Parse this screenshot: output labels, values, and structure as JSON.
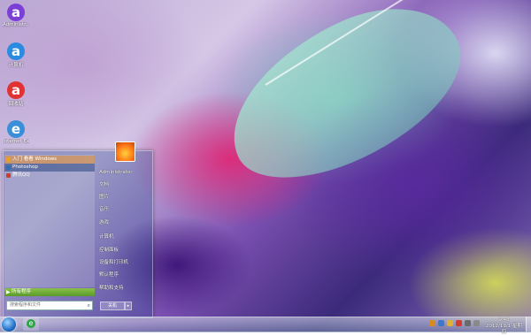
{
  "desktop_icons": [
    {
      "label": "Administr...",
      "glyph": "a",
      "color": "#7b3fd6"
    },
    {
      "label": "计算机",
      "glyph": "a",
      "color": "#2a8be0"
    },
    {
      "label": "回收站",
      "glyph": "a",
      "color": "#e03232"
    },
    {
      "label": "Internet Explorer",
      "glyph": "e",
      "color": "#3a8fd8"
    }
  ],
  "start_menu": {
    "programs": [
      {
        "label": "入门 看看 Windows",
        "color": "#e8a020"
      },
      {
        "label": "Photoshop",
        "color": "#2c6fb8"
      },
      {
        "label": "腾讯QQ",
        "color": "#d23a2a"
      }
    ],
    "all_programs": "所有程序",
    "search_placeholder": "搜索程序和文件",
    "user": "Administrator",
    "right_items": [
      "文档",
      "图片",
      "音乐",
      "游戏",
      "计算机",
      "控制面板",
      "设备和打印机",
      "默认程序",
      "帮助和支持"
    ],
    "shutdown": "关机"
  },
  "taskbar": {
    "time": "9:48",
    "date": "2012/11/1 星期四"
  }
}
